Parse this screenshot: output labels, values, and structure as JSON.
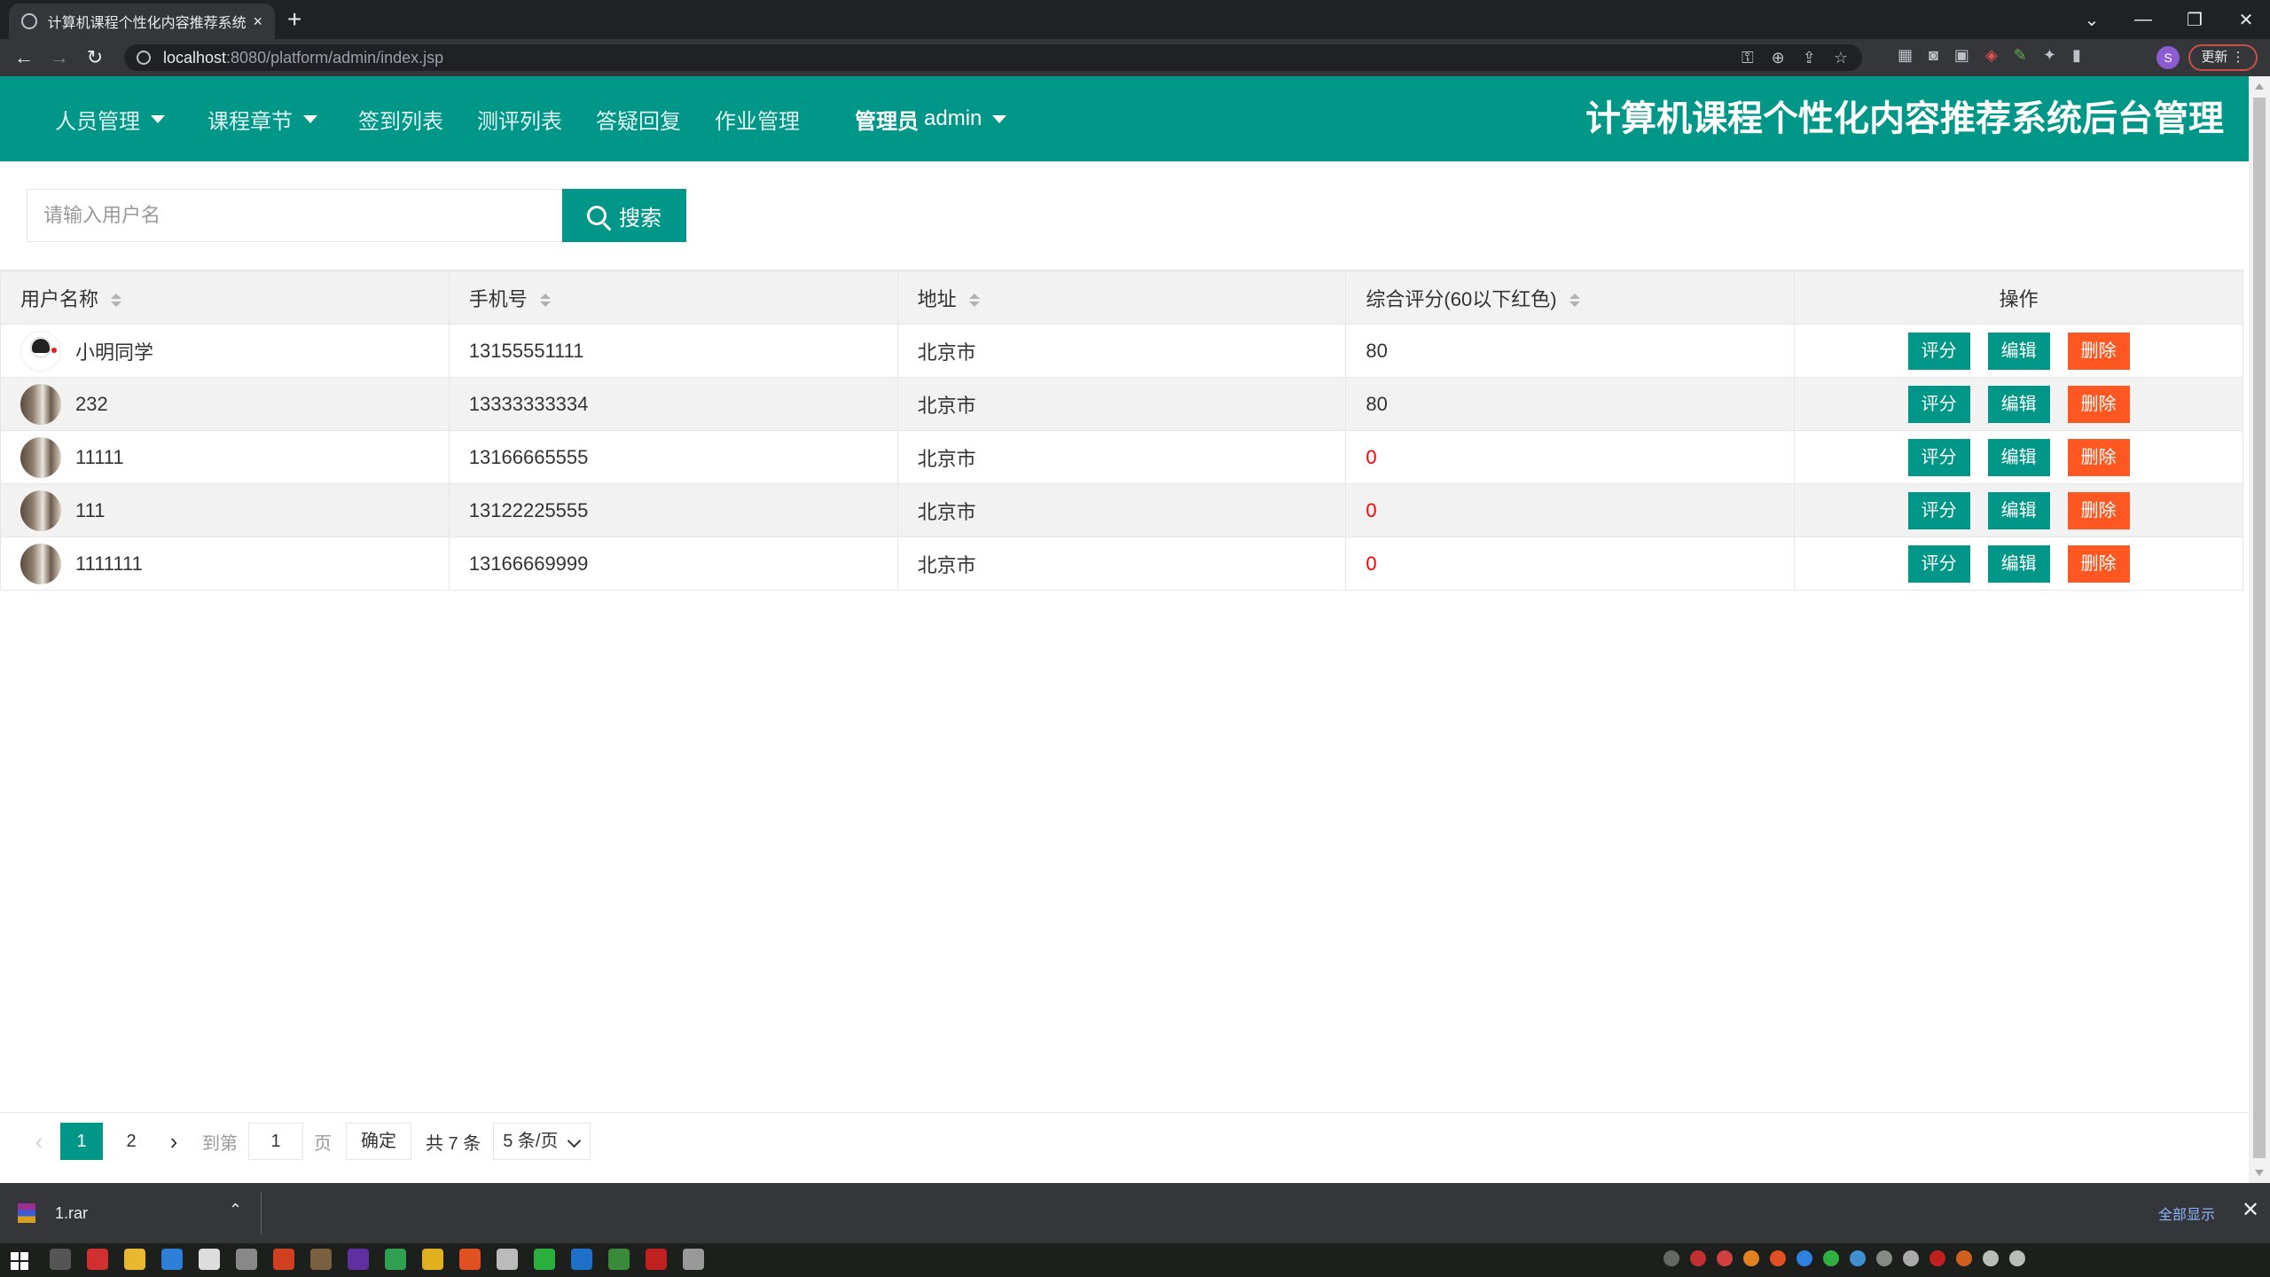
{
  "browser": {
    "tab_title": "计算机课程个性化内容推荐系统后",
    "tab_close": "×",
    "new_tab": "+",
    "url_host": "localhost",
    "url_path": ":8080/platform/admin/index.jsp",
    "update_label": "更新",
    "profile_initial": "S",
    "window_controls": [
      "⌄",
      "—",
      "❐",
      "✕"
    ]
  },
  "header": {
    "nav": [
      {
        "label": "人员管理",
        "dropdown": true
      },
      {
        "label": "课程章节",
        "dropdown": true
      },
      {
        "label": "签到列表",
        "dropdown": false
      },
      {
        "label": "测评列表",
        "dropdown": false
      },
      {
        "label": "答疑回复",
        "dropdown": false
      },
      {
        "label": "作业管理",
        "dropdown": false
      }
    ],
    "admin_role": "管理员",
    "admin_name": "admin",
    "system_title": "计算机课程个性化内容推荐系统后台管理",
    "background_color": "#009688"
  },
  "search": {
    "placeholder": "请输入用户名",
    "value": "",
    "button_label": "搜索"
  },
  "table": {
    "columns": [
      "用户名称",
      "手机号",
      "地址",
      "综合评分(60以下红色)",
      "操作"
    ],
    "rows": [
      {
        "name": "小明同学",
        "phone": "13155551111",
        "address": "北京市",
        "score": "80",
        "low": false,
        "avatar": "cartoon"
      },
      {
        "name": "232",
        "phone": "13333333334",
        "address": "北京市",
        "score": "80",
        "low": false,
        "avatar": "photo"
      },
      {
        "name": "11111",
        "phone": "13166665555",
        "address": "北京市",
        "score": "0",
        "low": true,
        "avatar": "photo"
      },
      {
        "name": "111",
        "phone": "13122225555",
        "address": "北京市",
        "score": "0",
        "low": true,
        "avatar": "photo"
      },
      {
        "name": "1111111",
        "phone": "13166669999",
        "address": "北京市",
        "score": "0",
        "low": true,
        "avatar": "photo"
      }
    ],
    "actions": {
      "rate": "评分",
      "edit": "编辑",
      "delete": "删除"
    },
    "low_score_color": "#ff0000"
  },
  "pagination": {
    "prev": "‹",
    "next": "›",
    "pages": [
      "1",
      "2"
    ],
    "current": "1",
    "goto_prefix": "到第",
    "goto_value": "1",
    "goto_suffix": "页",
    "confirm": "确定",
    "total": "共 7 条",
    "page_size": "5 条/页"
  },
  "downloads": {
    "file": "1.rar",
    "show_all": "全部显示",
    "close": "✕"
  }
}
